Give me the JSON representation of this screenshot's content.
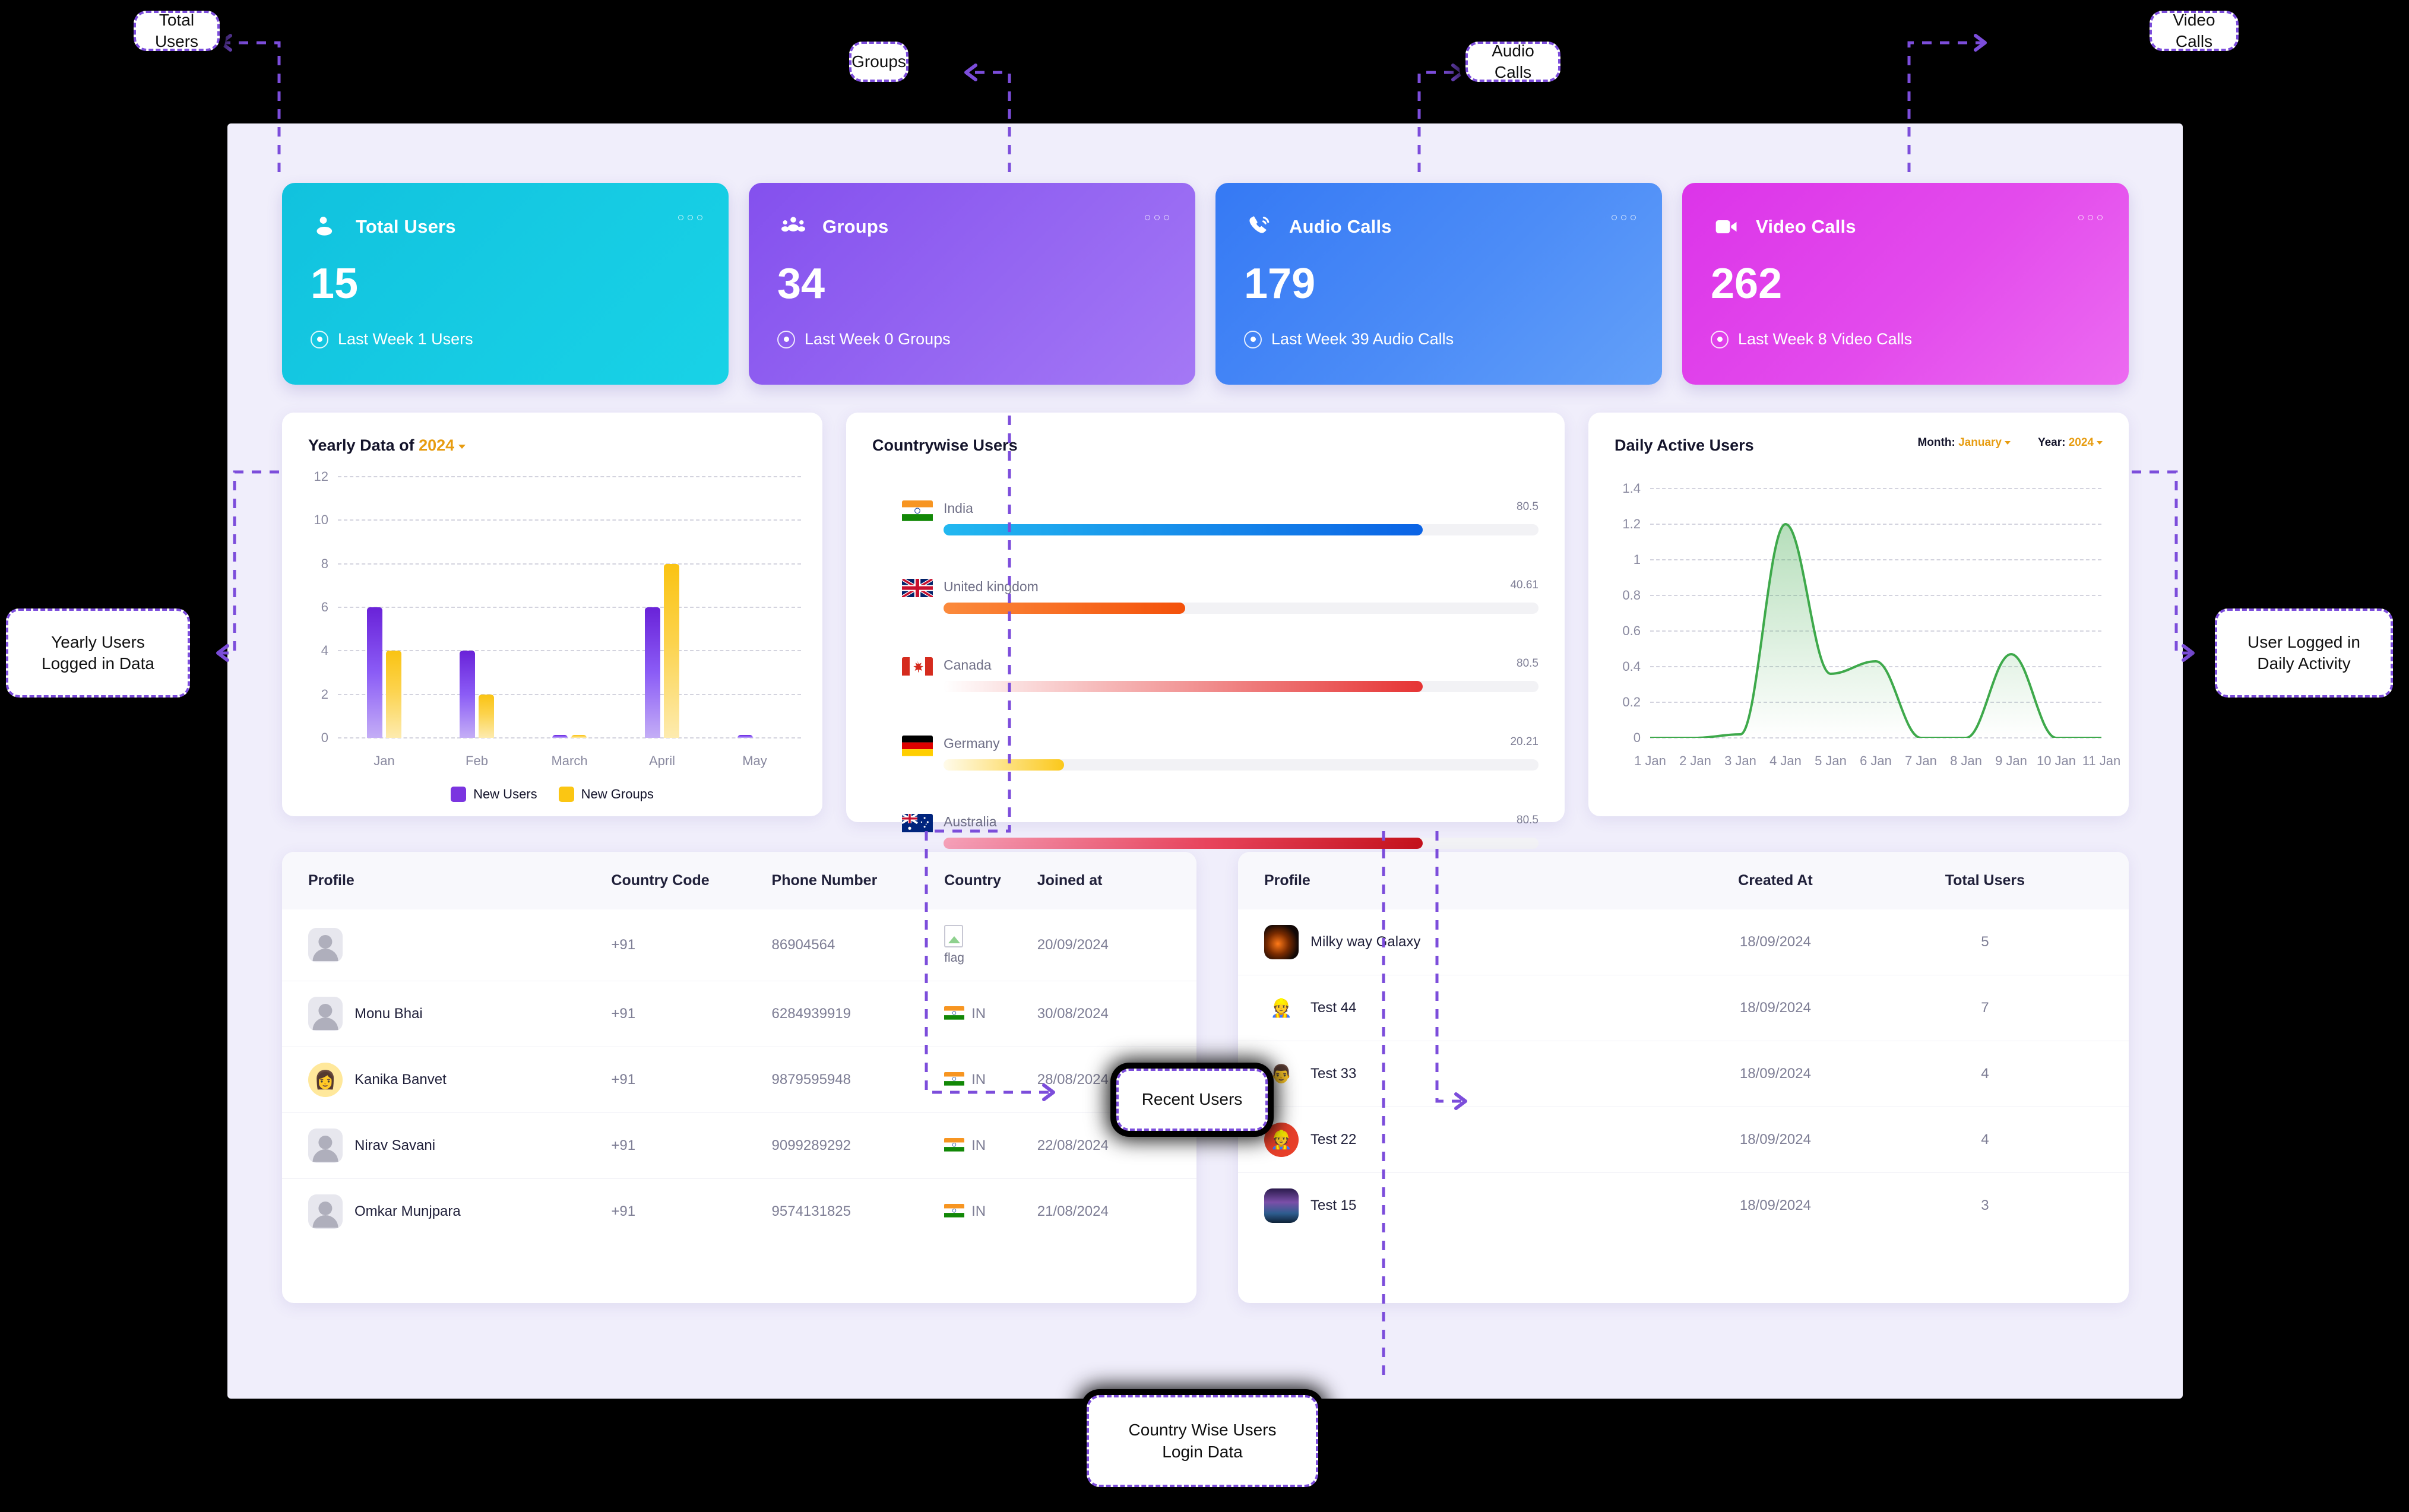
{
  "stats": [
    {
      "title": "Total Users",
      "value": "15",
      "footer": "Last Week 1 Users",
      "icon": "person-icon",
      "c1": "#17C0DE",
      "c2": "#0FC5D6"
    },
    {
      "title": "Groups",
      "value": "34",
      "footer": "Last Week 0 Groups",
      "icon": "group-icon",
      "c1": "#8B5BF0",
      "c2": "#A47BF5"
    },
    {
      "title": "Audio Calls",
      "value": "179",
      "footer": "Last Week 39 Audio Calls",
      "icon": "phone-call-icon",
      "c1": "#3B82F6",
      "c2": "#5C9BF8"
    },
    {
      "title": "Video Calls",
      "value": "262",
      "footer": "Last Week 8 Video Calls",
      "icon": "video-camera-icon",
      "c1": "#DE3BEA",
      "c2": "#E95FF0"
    }
  ],
  "yearly": {
    "title_prefix": "Yearly Data of ",
    "year": "2024",
    "legend": [
      "New Users",
      "New Groups"
    ]
  },
  "country": {
    "title": "Countrywise Users"
  },
  "daily": {
    "title": "Daily Active Users",
    "month_label": "Month:",
    "month_value": "January",
    "year_label": "Year:",
    "year_value": "2024"
  },
  "recent_table": {
    "columns": [
      "Profile",
      "Country Code",
      "Phone Number",
      "Country",
      "Joined at"
    ],
    "rows": [
      {
        "name": "",
        "avatar": "placeholder",
        "code": "+91",
        "phone": "86904564",
        "country": "",
        "country_broken": "flag",
        "joined": "20/09/2024"
      },
      {
        "name": "Monu Bhai",
        "avatar": "placeholder",
        "code": "+91",
        "phone": "6284939919",
        "country": "IN",
        "joined": "30/08/2024"
      },
      {
        "name": "Kanika Banvet",
        "avatar": "woman",
        "code": "+91",
        "phone": "9879595948",
        "country": "IN",
        "joined": "28/08/2024"
      },
      {
        "name": "Nirav Savani",
        "avatar": "placeholder",
        "code": "+91",
        "phone": "9099289292",
        "country": "IN",
        "joined": "22/08/2024"
      },
      {
        "name": "Omkar Munjpara",
        "avatar": "placeholder",
        "code": "+91",
        "phone": "9574131825",
        "country": "IN",
        "joined": "21/08/2024"
      }
    ]
  },
  "groups_table": {
    "columns": [
      "Profile",
      "Created At",
      "Total Users"
    ],
    "rows": [
      {
        "name": "Milky way Galaxy",
        "avatar": "galaxy",
        "created": "18/09/2024",
        "total": "5"
      },
      {
        "name": "Test 44",
        "avatar": "man-1",
        "created": "18/09/2024",
        "total": "7"
      },
      {
        "name": "Test 33",
        "avatar": "man-2",
        "created": "18/09/2024",
        "total": "4"
      },
      {
        "name": "Test 22",
        "avatar": "worker",
        "created": "18/09/2024",
        "total": "4"
      },
      {
        "name": "Test 15",
        "avatar": "night",
        "created": "18/09/2024",
        "total": "3"
      }
    ]
  },
  "annotations": [
    {
      "id": "a-total-users",
      "label": "Total Users"
    },
    {
      "id": "a-groups",
      "label": "Groups"
    },
    {
      "id": "a-audio-calls",
      "label": "Audio Calls"
    },
    {
      "id": "a-video-calls",
      "label": "Video Calls"
    },
    {
      "id": "a-yearly",
      "label": "Yearly Users\nLogged in Data"
    },
    {
      "id": "a-daily",
      "label": "User Logged in\nDaily Activity"
    },
    {
      "id": "a-recent",
      "label": "Recent Users"
    },
    {
      "id": "a-countrywise",
      "label": "Country Wise Users\nLogin Data"
    }
  ],
  "chart_data": [
    {
      "type": "bar",
      "title": "Yearly Data of 2024",
      "categories": [
        "Jan",
        "Feb",
        "March",
        "April",
        "May"
      ],
      "series": [
        {
          "name": "New Users",
          "values": [
            6,
            4,
            0.1,
            6,
            0.1
          ],
          "color": "#7B35E0"
        },
        {
          "name": "New Groups",
          "values": [
            4,
            2,
            0.1,
            8,
            0
          ],
          "color": "#FBC613"
        }
      ],
      "ylim": [
        0,
        12
      ],
      "yticks": [
        0,
        2,
        4,
        6,
        8,
        10,
        12
      ],
      "xlabel": "",
      "ylabel": "",
      "grid": true,
      "legend_position": "bottom"
    },
    {
      "type": "bar",
      "orientation": "horizontal",
      "title": "Countrywise Users",
      "categories": [
        "India",
        "United kingdom",
        "Canada",
        "Germany",
        "Australia"
      ],
      "values": [
        80.5,
        40.61,
        80.5,
        20.21,
        80.5
      ],
      "value_labels": [
        "80.5",
        "40.61",
        "80.5",
        "20.21",
        "80.5"
      ],
      "flags": [
        "in",
        "gb",
        "ca",
        "de",
        "au"
      ],
      "max": 100,
      "bar_colors": [
        "#0B63E5",
        "#F4510A",
        "#E63434",
        "#FBC81A",
        "#C4121B"
      ],
      "grid": false
    },
    {
      "type": "area",
      "title": "Daily Active Users",
      "x": [
        "1 Jan",
        "2 Jan",
        "3 Jan",
        "4 Jan",
        "5 Jan",
        "6 Jan",
        "7 Jan",
        "8 Jan",
        "9 Jan",
        "10 Jan",
        "11 Jan"
      ],
      "values": [
        0,
        0,
        0.02,
        1.2,
        0.36,
        0.43,
        0,
        0,
        0.47,
        0,
        0
      ],
      "ylim": [
        0,
        1.4
      ],
      "yticks": [
        0,
        0.2,
        0.4,
        0.6,
        0.8,
        1,
        1.2,
        1.4
      ],
      "line_color": "#3EA94B",
      "grid": true,
      "legend_position": "none"
    }
  ]
}
